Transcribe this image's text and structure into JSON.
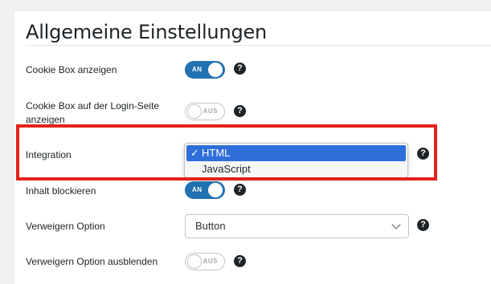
{
  "section": {
    "title": "Allgemeine Einstellungen"
  },
  "rows": {
    "cookie_box": {
      "label": "Cookie Box anzeigen",
      "toggle": "AN",
      "state": "on"
    },
    "login_page": {
      "label": "Cookie Box auf der Login-Seite anzeigen",
      "toggle": "AUS",
      "state": "off"
    },
    "integration": {
      "label": "Integration",
      "options": [
        {
          "label": "HTML",
          "selected": true,
          "check": "✓"
        },
        {
          "label": "JavaScript",
          "selected": false
        }
      ]
    },
    "block_content": {
      "label": "Inhalt blockieren",
      "toggle": "AN",
      "state": "on"
    },
    "deny_option": {
      "label": "Verweigern Option",
      "value": "Button"
    },
    "hide_deny": {
      "label": "Verweigern Option ausblenden",
      "toggle": "AUS",
      "state": "off"
    }
  },
  "help_glyph": "?",
  "colors": {
    "accent": "#2271b1",
    "highlight": "#e2231a",
    "selected_option": "#2f6fdb"
  }
}
